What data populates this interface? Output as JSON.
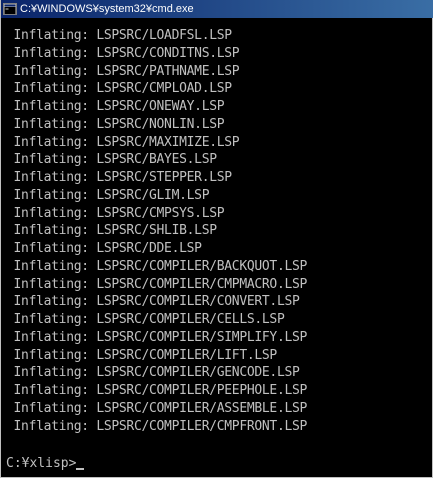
{
  "window": {
    "title": "C:¥WINDOWS¥system32¥cmd.exe",
    "icon": "console-icon"
  },
  "console": {
    "lines": [
      " Inflating: LSPSRC/LOADFSL.LSP",
      " Inflating: LSPSRC/CONDITNS.LSP",
      " Inflating: LSPSRC/PATHNAME.LSP",
      " Inflating: LSPSRC/CMPLOAD.LSP",
      " Inflating: LSPSRC/ONEWAY.LSP",
      " Inflating: LSPSRC/NONLIN.LSP",
      " Inflating: LSPSRC/MAXIMIZE.LSP",
      " Inflating: LSPSRC/BAYES.LSP",
      " Inflating: LSPSRC/STEPPER.LSP",
      " Inflating: LSPSRC/GLIM.LSP",
      " Inflating: LSPSRC/CMPSYS.LSP",
      " Inflating: LSPSRC/SHLIB.LSP",
      " Inflating: LSPSRC/DDE.LSP",
      " Inflating: LSPSRC/COMPILER/BACKQUOT.LSP",
      " Inflating: LSPSRC/COMPILER/CMPMACRO.LSP",
      " Inflating: LSPSRC/COMPILER/CONVERT.LSP",
      " Inflating: LSPSRC/COMPILER/CELLS.LSP",
      " Inflating: LSPSRC/COMPILER/SIMPLIFY.LSP",
      " Inflating: LSPSRC/COMPILER/LIFT.LSP",
      " Inflating: LSPSRC/COMPILER/GENCODE.LSP",
      " Inflating: LSPSRC/COMPILER/PEEPHOLE.LSP",
      " Inflating: LSPSRC/COMPILER/ASSEMBLE.LSP",
      " Inflating: LSPSRC/COMPILER/CMPFRONT.LSP"
    ],
    "prompt": "C:¥xlisp>"
  },
  "colors": {
    "console_background": "#000000",
    "console_text": "#c0c0c0",
    "titlebar": "#0a246a"
  }
}
